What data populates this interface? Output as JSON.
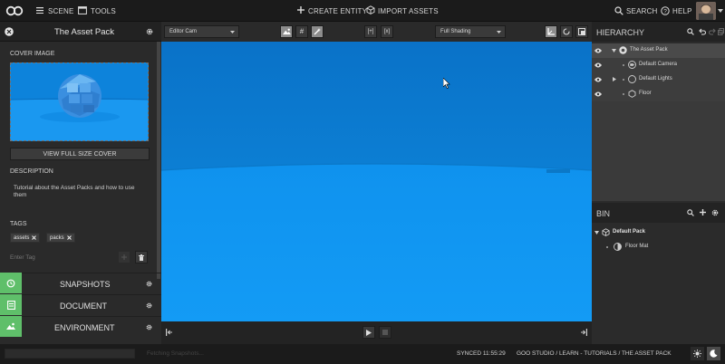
{
  "topbar": {
    "scene_label": "SCENE",
    "tools_label": "TOOLS",
    "create_entity_label": "CREATE ENTITY",
    "import_assets_label": "IMPORT ASSETS",
    "search_label": "SEARCH",
    "help_label": "HELP"
  },
  "left_panel": {
    "title": "The Asset Pack",
    "cover_image_label": "COVER IMAGE",
    "view_full_size_label": "VIEW FULL SIZE COVER",
    "description_label": "DESCRIPTION",
    "description_text": "Tutorial about the Asset Packs and how to use them",
    "tags_label": "TAGS",
    "tags": [
      "assets",
      "packs"
    ],
    "enter_tag_placeholder": "Enter Tag",
    "sections": [
      {
        "label": "SNAPSHOTS"
      },
      {
        "label": "DOCUMENT"
      },
      {
        "label": "ENVIRONMENT"
      }
    ]
  },
  "toolbar": {
    "camera_select": "Editor Cam",
    "shading_select": "Full Shading"
  },
  "hierarchy": {
    "title": "HIERARCHY",
    "items": [
      {
        "label": "The Asset Pack"
      },
      {
        "label": "Default Camera"
      },
      {
        "label": "Default Lights"
      },
      {
        "label": "Floor"
      }
    ]
  },
  "bin": {
    "title": "BIN",
    "pack_label": "Default Pack",
    "items": [
      {
        "label": "Floor Mat"
      }
    ]
  },
  "status": {
    "faded_text": "Fetching Snapshots...",
    "synced_text": "SYNCED 11:55:29",
    "breadcrumb": "GOO STUDIO / LEARN - TUTORIALS / THE ASSET PACK"
  },
  "colors": {
    "viewport_sky": "#0f96f2",
    "horizon": "#0c7fd0",
    "side_tab_green": "#5fbf6a",
    "hierarchy_selected": "#4a4a4a"
  }
}
